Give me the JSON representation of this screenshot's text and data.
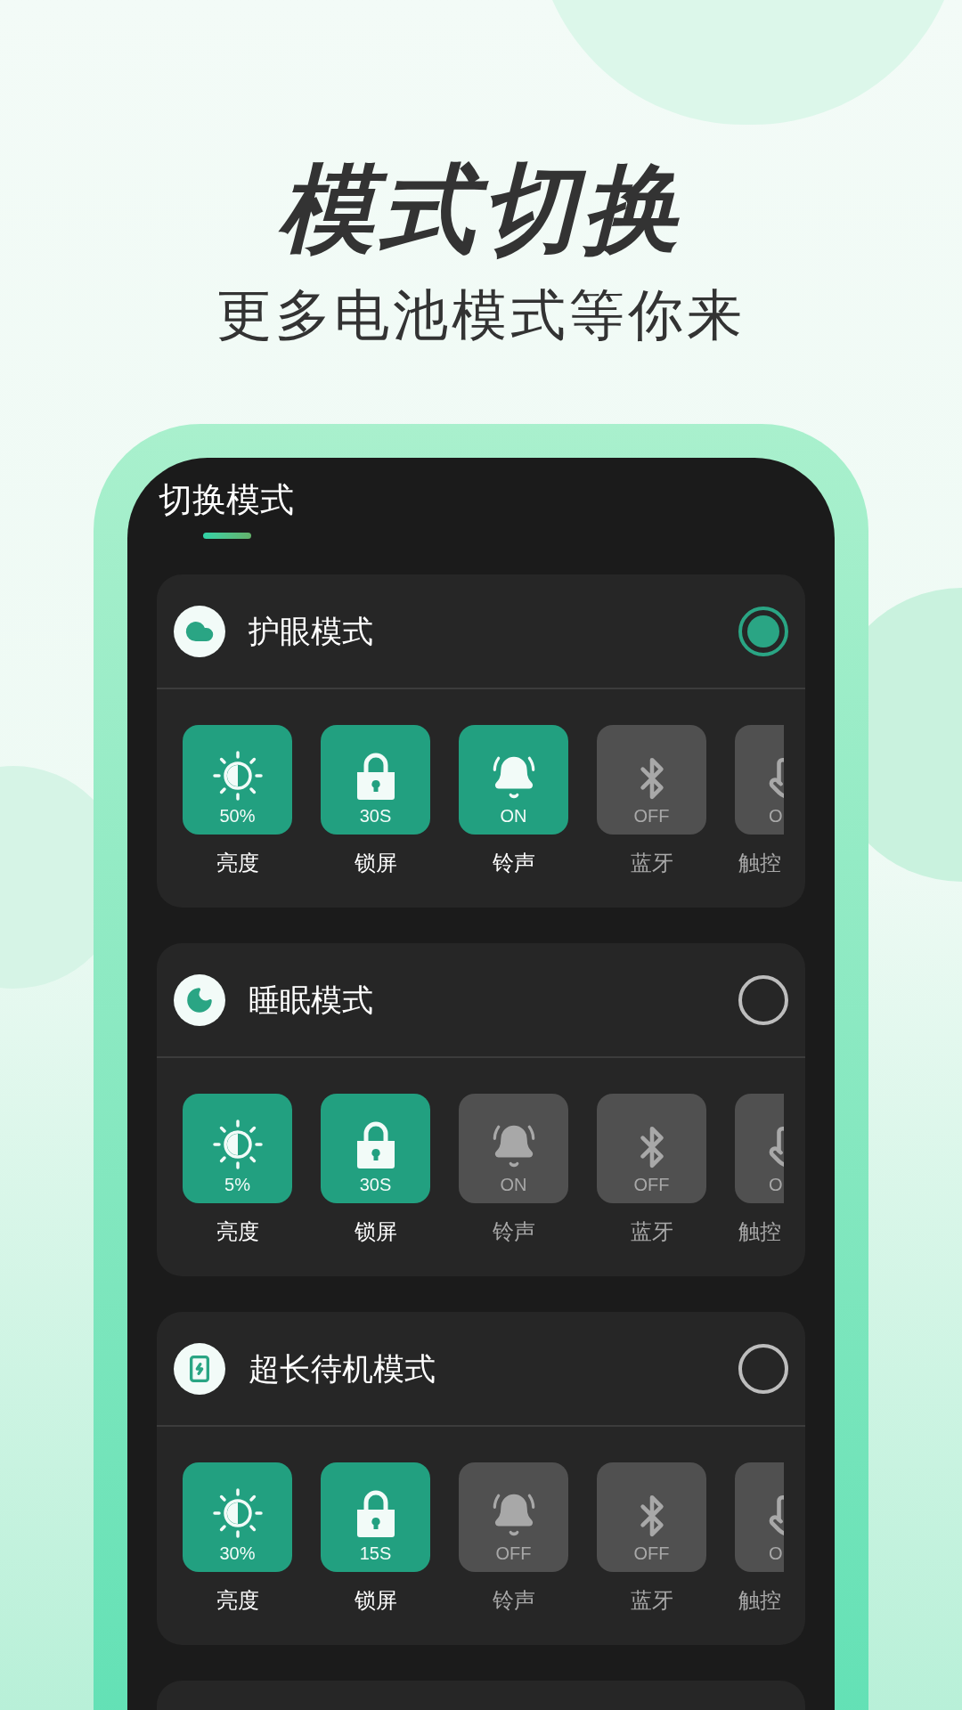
{
  "headline": "模式切换",
  "subtitle": "更多电池模式等你来",
  "screen": {
    "title": "切换模式",
    "modes": [
      {
        "name": "护眼模式",
        "selected": true,
        "settings": [
          {
            "value": "50%",
            "label": "亮度",
            "on": true
          },
          {
            "value": "30S",
            "label": "锁屏",
            "on": true
          },
          {
            "value": "ON",
            "label": "铃声",
            "on": true
          },
          {
            "value": "OFF",
            "label": "蓝牙",
            "on": false
          },
          {
            "value": "O",
            "label": "触控",
            "on": false
          }
        ]
      },
      {
        "name": "睡眠模式",
        "selected": false,
        "settings": [
          {
            "value": "5%",
            "label": "亮度",
            "on": true
          },
          {
            "value": "30S",
            "label": "锁屏",
            "on": true
          },
          {
            "value": "ON",
            "label": "铃声",
            "on": false
          },
          {
            "value": "OFF",
            "label": "蓝牙",
            "on": false
          },
          {
            "value": "O",
            "label": "触控",
            "on": false
          }
        ]
      },
      {
        "name": "超长待机模式",
        "selected": false,
        "settings": [
          {
            "value": "30%",
            "label": "亮度",
            "on": true
          },
          {
            "value": "15S",
            "label": "锁屏",
            "on": true
          },
          {
            "value": "OFF",
            "label": "铃声",
            "on": false
          },
          {
            "value": "OFF",
            "label": "蓝牙",
            "on": false
          },
          {
            "value": "O",
            "label": "触控",
            "on": false
          }
        ]
      }
    ]
  }
}
